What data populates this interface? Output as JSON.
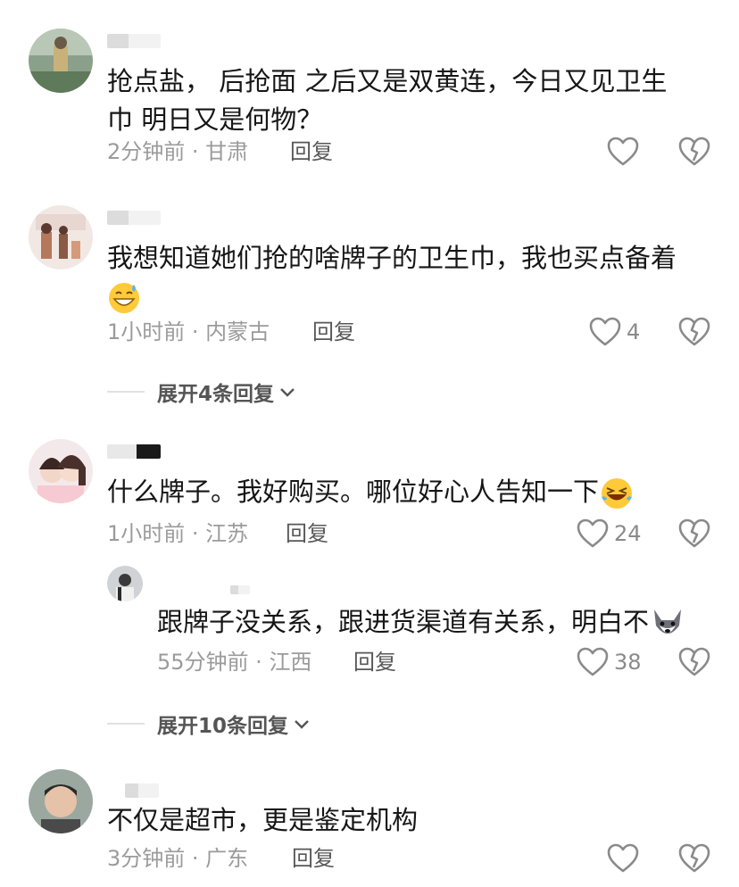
{
  "comments": [
    {
      "text": "抢点盐，  后抢面 之后又是双黄连，今日又见卫生巾  明日又是何物？",
      "line1": "抢点盐，  后抢面 之后又是双黄连，今日又见卫生",
      "line2": "巾  明日又是何物？",
      "time": "2分钟前",
      "location": "甘肃",
      "reply_label": "回复",
      "likes": ""
    },
    {
      "text": "我想知道她们抢的啥牌子的卫生巾，我也买点备着",
      "time": "1小时前",
      "location": "内蒙古",
      "reply_label": "回复",
      "likes": "4",
      "expand_label": "展开4条回复"
    },
    {
      "text": "什么牌子。我好购买。哪位好心人告知一下",
      "time": "1小时前",
      "location": "江苏",
      "reply_label": "回复",
      "likes": "24",
      "reply": {
        "text": "跟牌子没关系，跟进货渠道有关系，明白不",
        "time": "55分钟前",
        "location": "江西",
        "reply_label": "回复",
        "likes": "38"
      },
      "expand_label": "展开10条回复"
    },
    {
      "text": "不仅是超市，更是鉴定机构",
      "time": "3分钟前",
      "location": "广东",
      "reply_label": "回复",
      "likes": ""
    }
  ],
  "separator": " · ",
  "icons": {
    "like": "heart-outline-icon",
    "dislike": "broken-heart-icon",
    "expand": "chevron-down-icon"
  },
  "colors": {
    "text": "#161616",
    "meta": "#9b9b9b",
    "icon": "#8a8a8a"
  }
}
